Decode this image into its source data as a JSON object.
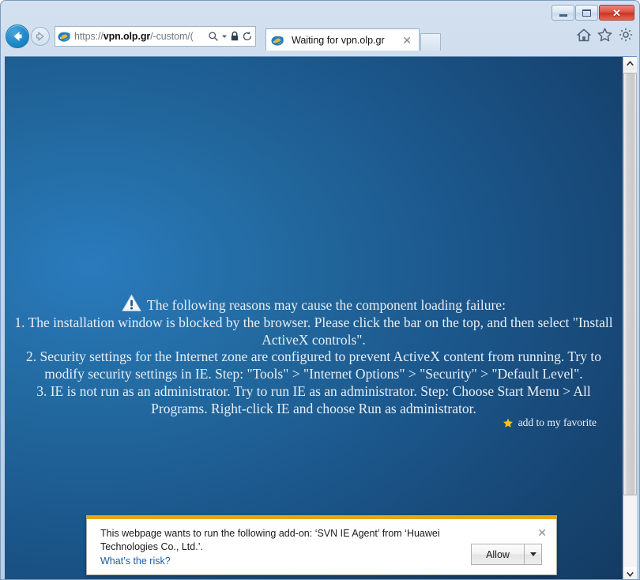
{
  "window": {
    "controls": {
      "minimize": "Minimize",
      "maximize": "Maximize",
      "close": "✕"
    }
  },
  "navigation": {
    "back_label": "Back",
    "forward_label": "Forward",
    "address": {
      "scheme": "https://",
      "host": "vpn.olp.gr",
      "path": "/-custom/(",
      "full": "https://vpn.olp.gr/-custom/(",
      "icons": [
        "search-icon",
        "dropdown-arrow-icon",
        "lock-icon",
        "refresh-icon"
      ]
    }
  },
  "tabs": [
    {
      "title": "Waiting for vpn.olp.gr",
      "close": "✕",
      "active": true
    }
  ],
  "toolbar_right": {
    "home": "Home",
    "favorites": "Favorites",
    "tools": "Tools"
  },
  "page": {
    "message_lines": [
      "The following reasons may cause the component loading failure:",
      "1. The installation window is blocked by the browser. Please click the bar on the top, and then select \"Install ActiveX controls\".",
      "2. Security settings for the Internet zone are configured to prevent ActiveX content from running. Try to modify security settings in IE. Step: \"Tools\" > \"Internet Options\" > \"Security\" > \"Default Level\".",
      "3. IE is not run as an administrator. Try to run IE as an administrator. Step: Choose Start Menu > All Programs. Right-click IE and choose Run as administrator."
    ],
    "favorite_link": "add to my favorite",
    "background_color": "#1b5589",
    "text_color": "#e8eef6"
  },
  "notification": {
    "text": "This webpage wants to run the following add-on: ‘SVN IE Agent’ from ‘Huawei Technologies Co., Ltd.’.",
    "link": "What’s the risk?",
    "allow_label": "Allow",
    "close": "✕",
    "accent_color": "#e6a614"
  },
  "scrollbar": {
    "up": "⌃",
    "down": "⌄"
  }
}
